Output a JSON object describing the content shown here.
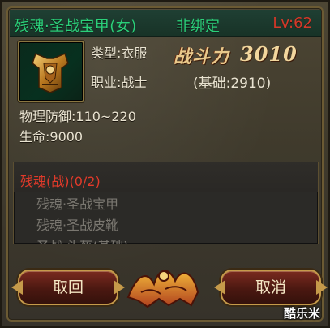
{
  "item": {
    "name": "残魂·圣战宝甲(女)",
    "binding": "非绑定",
    "level": "Lv:62",
    "type": "类型:衣服",
    "profession": "职业:战士",
    "power_label": "战斗力",
    "power_value": "3010",
    "base_power": "(基础:2910)",
    "physical_defense": "物理防御:110~220",
    "hp": "生命:9000"
  },
  "set": {
    "title": "残魂(战)(0/2)",
    "pieces": [
      "残魂·圣战宝甲",
      "残魂·圣战皮靴",
      "圣战·头盔(基础)"
    ]
  },
  "buttons": {
    "back": "取回",
    "cancel": "取消"
  },
  "watermark": "酷乐米",
  "colors": {
    "item_name": "#2bd07a",
    "level": "#d23a2a",
    "set_title": "#e23a2a",
    "set_piece_inactive": "#7a7770"
  }
}
